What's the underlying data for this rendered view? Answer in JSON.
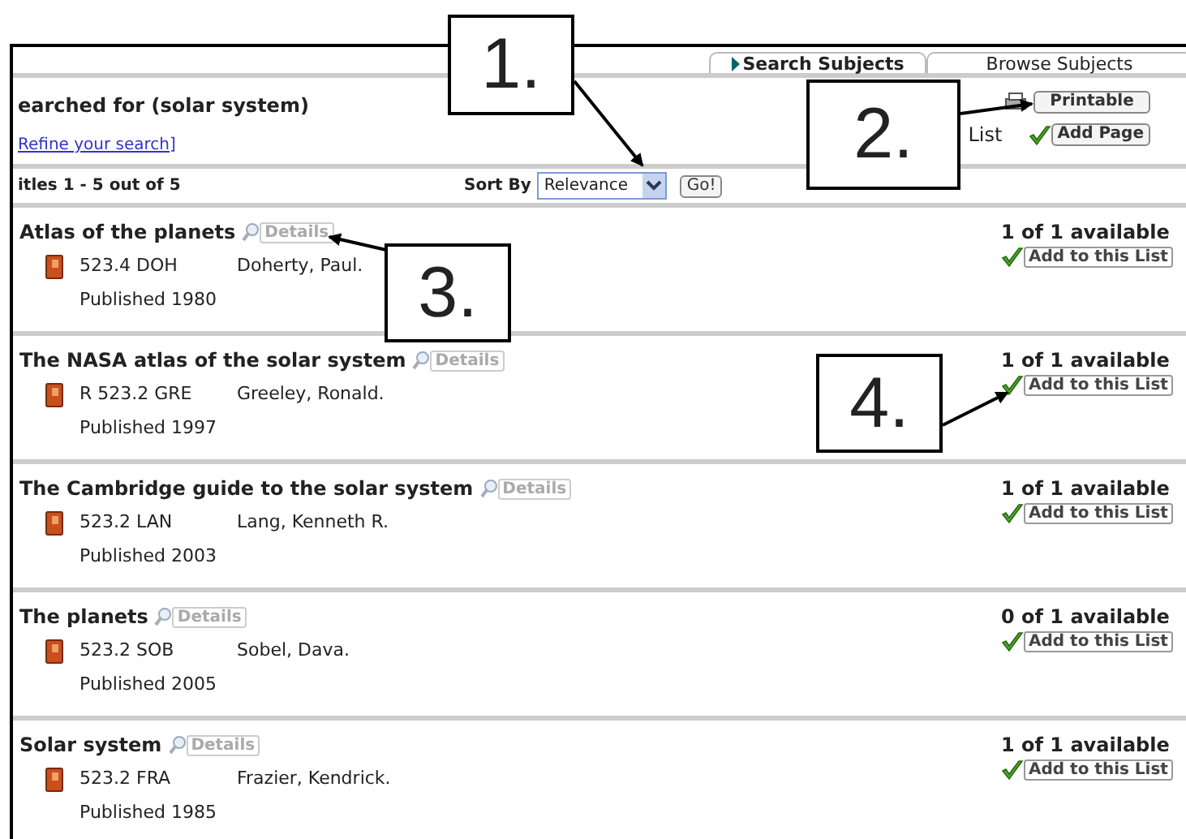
{
  "tabs": [
    {
      "label": "Search Subjects",
      "selected": true
    },
    {
      "label": "Browse Subjects",
      "selected": false
    }
  ],
  "search": {
    "heading": "earched for (solar system)",
    "refine_link": "Refine your search",
    "refine_bracket": "]"
  },
  "tools": {
    "printable_button": "Printable",
    "list_label": "List",
    "add_page_button": "Add Page"
  },
  "results_count": "itles 1 - 5 out of 5",
  "sort": {
    "label": "Sort By",
    "value": "Relevance",
    "go_button": "Go!"
  },
  "results": [
    {
      "title": "Atlas of the planets",
      "details_button": "Details",
      "call_number": "523.4 DOH",
      "author": "Doherty, Paul.",
      "published": "Published 1980",
      "availability": "1 of 1 available",
      "add_button": "Add to this List"
    },
    {
      "title": "The NASA atlas of the solar system",
      "details_button": "Details",
      "call_number": "R 523.2 GRE",
      "author": "Greeley, Ronald.",
      "published": "Published 1997",
      "availability": "1 of 1 available",
      "add_button": "Add to this List"
    },
    {
      "title": "The Cambridge guide to the solar system",
      "details_button": "Details",
      "call_number": "523.2 LAN",
      "author": "Lang, Kenneth R.",
      "published": "Published 2003",
      "availability": "1 of 1 available",
      "add_button": "Add to this List"
    },
    {
      "title": "The planets",
      "details_button": "Details",
      "call_number": "523.2 SOB",
      "author": "Sobel, Dava.",
      "published": "Published 2005",
      "availability": "0 of 1 available",
      "add_button": "Add to this List"
    },
    {
      "title": "Solar system",
      "details_button": "Details",
      "call_number": "523.2 FRA",
      "author": "Frazier, Kendrick.",
      "published": "Published 1985",
      "availability": "1 of 1 available",
      "add_button": "Add to this List"
    }
  ],
  "callouts": [
    {
      "label": "1."
    },
    {
      "label": "2."
    },
    {
      "label": "3."
    },
    {
      "label": "4."
    }
  ]
}
